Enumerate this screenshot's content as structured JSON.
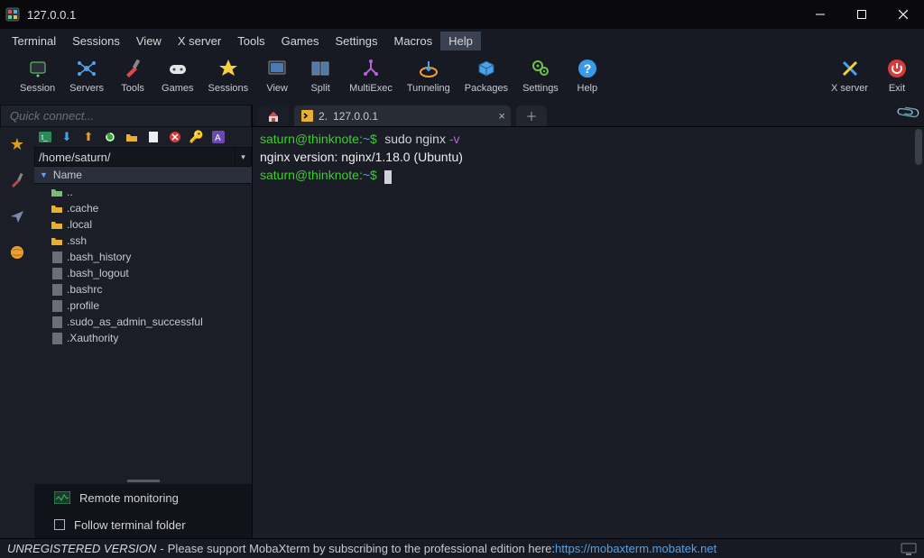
{
  "window": {
    "title": "127.0.0.1"
  },
  "menus": [
    "Terminal",
    "Sessions",
    "View",
    "X server",
    "Tools",
    "Games",
    "Settings",
    "Macros",
    "Help"
  ],
  "menu_active_index": 8,
  "toolbar": [
    {
      "label": "Session",
      "icon": "session"
    },
    {
      "label": "Servers",
      "icon": "servers"
    },
    {
      "label": "Tools",
      "icon": "tools"
    },
    {
      "label": "Games",
      "icon": "games"
    },
    {
      "label": "Sessions",
      "icon": "sessions"
    },
    {
      "label": "View",
      "icon": "view"
    },
    {
      "label": "Split",
      "icon": "split"
    },
    {
      "label": "MultiExec",
      "icon": "multiexec"
    },
    {
      "label": "Tunneling",
      "icon": "tunneling"
    },
    {
      "label": "Packages",
      "icon": "packages"
    },
    {
      "label": "Settings",
      "icon": "settings"
    },
    {
      "label": "Help",
      "icon": "help"
    }
  ],
  "toolbar_right": [
    {
      "label": "X server",
      "icon": "xserver"
    },
    {
      "label": "Exit",
      "icon": "exit"
    }
  ],
  "quick_connect_placeholder": "Quick connect...",
  "path": "/home/saturn/",
  "name_header": "Name",
  "files": [
    {
      "name": "..",
      "type": "up"
    },
    {
      "name": ".cache",
      "type": "folder"
    },
    {
      "name": ".local",
      "type": "folder"
    },
    {
      "name": ".ssh",
      "type": "folder"
    },
    {
      "name": ".bash_history",
      "type": "file"
    },
    {
      "name": ".bash_logout",
      "type": "file"
    },
    {
      "name": ".bashrc",
      "type": "file"
    },
    {
      "name": ".profile",
      "type": "file"
    },
    {
      "name": ".sudo_as_admin_successful",
      "type": "file"
    },
    {
      "name": ".Xauthority",
      "type": "file"
    }
  ],
  "remote_monitoring_label": "Remote monitoring",
  "follow_label": "Follow terminal folder",
  "tabs": {
    "active": {
      "index": "2.",
      "title": "127.0.0.1"
    }
  },
  "terminal": {
    "prompt1_user": "saturn@thinknote",
    "prompt1_path": "~",
    "cmd1_a": "sudo nginx ",
    "cmd1_flag": "-v",
    "output_line": "nginx version: nginx/1.18.0 (Ubuntu)",
    "prompt2_user": "saturn@thinknote",
    "prompt2_path": "~"
  },
  "status": {
    "unreg": "UNREGISTERED VERSION",
    "dash": " - ",
    "msg": "Please support MobaXterm by subscribing to the professional edition here:  ",
    "url": "https://mobaxterm.mobatek.net"
  }
}
